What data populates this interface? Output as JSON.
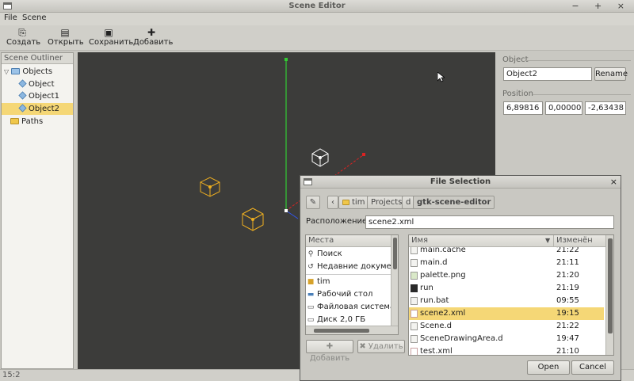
{
  "window": {
    "title": "Scene Editor",
    "controls": "− + ×"
  },
  "menu": {
    "file": "File",
    "scene": "Scene"
  },
  "toolbar": {
    "create": "Создать",
    "open": "Открыть",
    "save": "Сохранить",
    "add": "Добавить"
  },
  "outliner": {
    "title": "Scene Outliner",
    "objects_label": "Objects",
    "items": [
      "Object",
      "Object1",
      "Object2"
    ],
    "paths_label": "Paths"
  },
  "properties": {
    "object_group": "Object",
    "object_name": "Object2",
    "rename": "Rename",
    "position_group": "Position",
    "position": [
      "6,89816",
      "0,00000",
      "-2,63438"
    ]
  },
  "status": "15:2",
  "dialog": {
    "title": "File Selection",
    "breadcrumbs": [
      "tim",
      "Projects",
      "d",
      "gtk-scene-editor"
    ],
    "location_label": "Расположение:",
    "location_value": "scene2.xml",
    "places_header": "Места",
    "places": [
      "Поиск",
      "Недавние документы",
      "tim",
      "Рабочий стол",
      "Файловая система",
      "Диск 2,0 ГБ"
    ],
    "add_button": "Добавить",
    "remove_button": "Удалить",
    "col_name": "Имя",
    "col_modified": "Изменён",
    "files": [
      {
        "name": "main.cache",
        "date": "21:22"
      },
      {
        "name": "main.d",
        "date": "21:11"
      },
      {
        "name": "palette.png",
        "date": "21:20"
      },
      {
        "name": "run",
        "date": "21:19"
      },
      {
        "name": "run.bat",
        "date": "09:55"
      },
      {
        "name": "scene2.xml",
        "date": "19:15"
      },
      {
        "name": "Scene.d",
        "date": "21:22"
      },
      {
        "name": "SceneDrawingArea.d",
        "date": "19:47"
      },
      {
        "name": "test.xml",
        "date": "21:10"
      }
    ],
    "open": "Open",
    "cancel": "Cancel"
  },
  "colors": {
    "selection": "#f5d776",
    "viewport": "#3c3c3a",
    "axis_y": "#33cc33",
    "axis_x": "#dd2222",
    "selected_object": "#f0b020"
  }
}
